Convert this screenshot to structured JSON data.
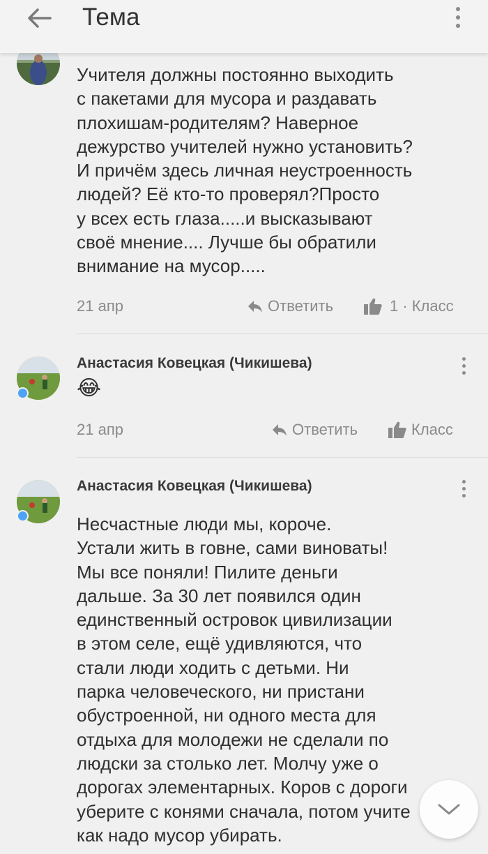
{
  "header": {
    "title": "Тема",
    "back_icon": "arrow-left-icon",
    "menu_icon": "more-vertical-icon"
  },
  "comments": [
    {
      "author": "",
      "text": "Учителя должны постоянно выходить\nс пакетами для мусора и раздавать\nплохишам-родителям? Наверное\nдежурство учителей нужно установить?\nИ причём здесь личная неустроенность\nлюдей? Её кто-то проверял?Просто\nу всех есть глаза.....и высказывают\nсвоё мнение.... Лучше бы обратили\nвнимание на мусор.....",
      "date": "21 апр",
      "reply_label": "Ответить",
      "like_count": "1 ·",
      "like_label": "Класс"
    },
    {
      "author": "Анастасия Ковецкая (Чикишева)",
      "text": "😂",
      "date": "21 апр",
      "reply_label": "Ответить",
      "like_label": "Класс"
    },
    {
      "author": "Анастасия Ковецкая (Чикишева)",
      "text": "Несчастные люди мы, короче.\nУстали жить в говне, сами виноваты!\nМы все поняли! Пилите деньги\nдальше. За 30 лет появился один\nединственный островок цивилизации\nв этом селе, ещё удивляются, что\nстали люди ходить с детьми. Ни\nпарка человеческого, ни пристани\nобустроенной, ни одного места для\nотдыха для молодежи не сделали по\nлюдски за столько лет. Молчу уже о\nдорогах элементарных. Коров с дороги\nуберите с конями сначала, потом учите\nкак надо мусор убирать."
    }
  ],
  "scroll_button_icon": "chevron-down-icon",
  "colors": {
    "background": "#f0f0f0",
    "online_indicator": "#4da3f5",
    "secondary_text": "#8a8a8a"
  }
}
